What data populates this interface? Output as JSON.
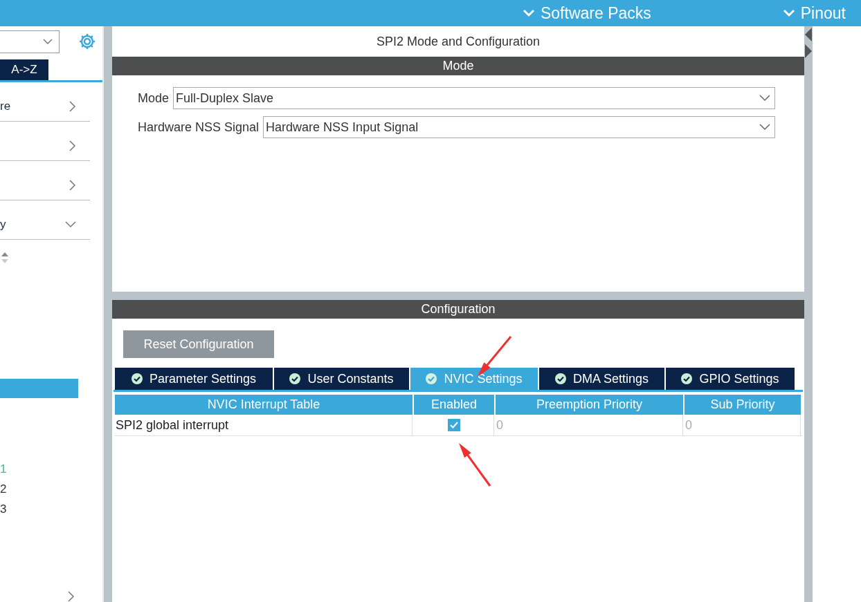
{
  "top_bar": {
    "menus": [
      {
        "label": "Software Packs"
      },
      {
        "label": "Pinout"
      }
    ]
  },
  "sidebar": {
    "tabs": [
      {
        "label": "A->Z",
        "selected": true
      }
    ],
    "categories": [
      {
        "label": "re",
        "expanded": false
      },
      {
        "expanded": false
      },
      {
        "expanded": false
      },
      {
        "label": "y",
        "expanded": true
      }
    ],
    "rows": [
      {
        "selected": true
      }
    ],
    "numbers": [
      {
        "label": "1",
        "color": "#3dbb8f"
      },
      {
        "label": "2",
        "color": "#333333"
      },
      {
        "label": "3",
        "color": "#333333"
      }
    ]
  },
  "panel": {
    "title": "SPI2 Mode and Configuration",
    "mode": {
      "header": "Mode",
      "fields": [
        {
          "label": "Mode",
          "value": "Full-Duplex Slave"
        },
        {
          "label": "Hardware NSS Signal",
          "value": "Hardware NSS Input Signal"
        }
      ]
    },
    "configuration": {
      "header": "Configuration",
      "reset_button": "Reset Configuration",
      "tabs": [
        {
          "label": "Parameter Settings",
          "selected": false
        },
        {
          "label": "User Constants",
          "selected": false
        },
        {
          "label": "NVIC Settings",
          "selected": true
        },
        {
          "label": "DMA Settings",
          "selected": false
        },
        {
          "label": "GPIO Settings",
          "selected": false
        }
      ],
      "table": {
        "columns": [
          "NVIC Interrupt Table",
          "Enabled",
          "Preemption Priority",
          "Sub Priority"
        ],
        "rows": [
          {
            "name": "SPI2 global interrupt",
            "enabled": true,
            "preemption_priority": "0",
            "sub_priority": "0"
          }
        ]
      }
    }
  },
  "annotations": [
    {
      "kind": "arrow"
    },
    {
      "kind": "arrow"
    }
  ]
}
